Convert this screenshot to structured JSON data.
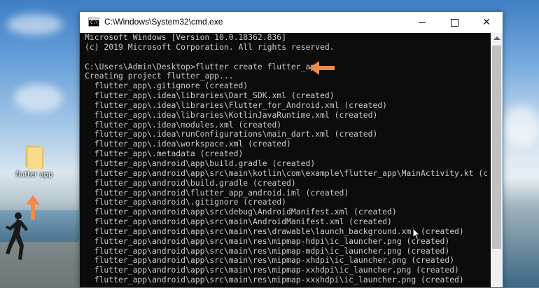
{
  "desktop": {
    "icon_label": "flutter app",
    "accent_color": "#f08a4b"
  },
  "window": {
    "title": "C:\\Windows\\System32\\cmd.exe",
    "minimize_label": "minimize",
    "maximize_label": "maximize",
    "close_label": "✕",
    "console_lines": [
      "Microsoft Windows [Version 10.0.18362.836]",
      "(c) 2019 Microsoft Corporation. All rights reserved.",
      "",
      "C:\\Users\\Admin\\Desktop>flutter create flutter_app",
      "Creating project flutter_app...",
      "  flutter_app\\.gitignore (created)",
      "  flutter_app\\.idea\\libraries\\Dart_SDK.xml (created)",
      "  flutter_app\\.idea\\libraries\\Flutter_for_Android.xml (created)",
      "  flutter_app\\.idea\\libraries\\KotlinJavaRuntime.xml (created)",
      "  flutter_app\\.idea\\modules.xml (created)",
      "  flutter_app\\.idea\\runConfigurations\\main_dart.xml (created)",
      "  flutter_app\\.idea\\workspace.xml (created)",
      "  flutter_app\\.metadata (created)",
      "  flutter_app\\android\\app\\build.gradle (created)",
      "  flutter_app\\android\\app\\src\\main\\kotlin\\com\\example\\flutter_app\\MainActivity.kt (created)",
      "  flutter_app\\android\\build.gradle (created)",
      "  flutter_app\\android\\flutter_app_android.iml (created)",
      "  flutter_app\\android\\.gitignore (created)",
      "  flutter_app\\android\\app\\src\\debug\\AndroidManifest.xml (created)",
      "  flutter_app\\android\\app\\src\\main\\AndroidManifest.xml (created)",
      "  flutter_app\\android\\app\\src\\main\\res\\drawable\\launch_background.xml (created)",
      "  flutter_app\\android\\app\\src\\main\\res\\mipmap-hdpi\\ic_launcher.png (created)",
      "  flutter_app\\android\\app\\src\\main\\res\\mipmap-mdpi\\ic_launcher.png (created)",
      "  flutter_app\\android\\app\\src\\main\\res\\mipmap-xhdpi\\ic_launcher.png (created)",
      "  flutter_app\\android\\app\\src\\main\\res\\mipmap-xxhdpi\\ic_launcher.png (created)",
      "  flutter_app\\android\\app\\src\\main\\res\\mipmap-xxxhdpi\\ic_launcher.png (created)"
    ]
  }
}
